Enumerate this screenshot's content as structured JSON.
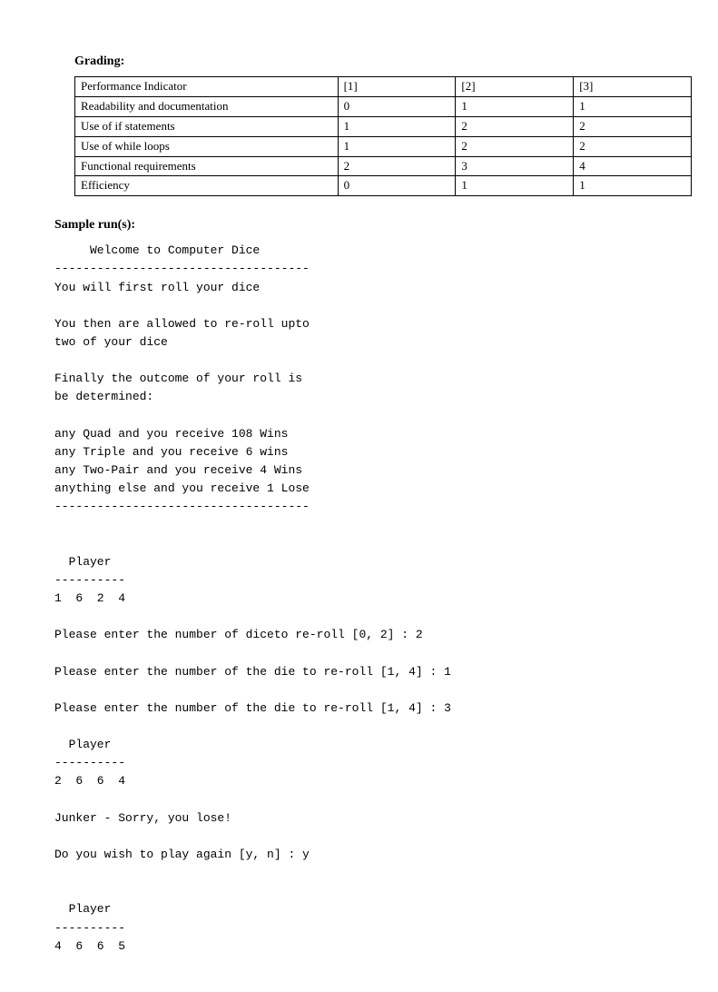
{
  "headings": {
    "grading": "Grading:",
    "sample": "Sample run(s):"
  },
  "table": {
    "header": {
      "c0": "Performance Indicator",
      "c1": "[1]",
      "c2": "[2]",
      "c3": "[3]"
    },
    "rows": [
      {
        "c0": "Readability and documentation",
        "c1": "0",
        "c2": "1",
        "c3": "1"
      },
      {
        "c0": "Use of if statements",
        "c1": "1",
        "c2": "2",
        "c3": "2"
      },
      {
        "c0": "Use of while loops",
        "c1": "1",
        "c2": "2",
        "c3": "2"
      },
      {
        "c0": "Functional requirements",
        "c1": "2",
        "c2": "3",
        "c3": "4"
      },
      {
        "c0": "Efficiency",
        "c1": "0",
        "c2": "1",
        "c3": "1"
      }
    ]
  },
  "sample_output": "     Welcome to Computer Dice\n------------------------------------\nYou will first roll your dice\n\nYou then are allowed to re-roll upto\ntwo of your dice\n\nFinally the outcome of your roll is\nbe determined:\n\nany Quad and you receive 108 Wins\nany Triple and you receive 6 wins\nany Two-Pair and you receive 4 Wins\nanything else and you receive 1 Lose\n------------------------------------\n\n\n  Player\n----------\n1  6  2  4\n\nPlease enter the number of diceto re-roll [0, 2] : 2\n\nPlease enter the number of the die to re-roll [1, 4] : 1\n\nPlease enter the number of the die to re-roll [1, 4] : 3\n\n  Player\n----------\n2  6  6  4\n\nJunker - Sorry, you lose!\n\nDo you wish to play again [y, n] : y\n\n\n  Player\n----------\n4  6  6  5"
}
